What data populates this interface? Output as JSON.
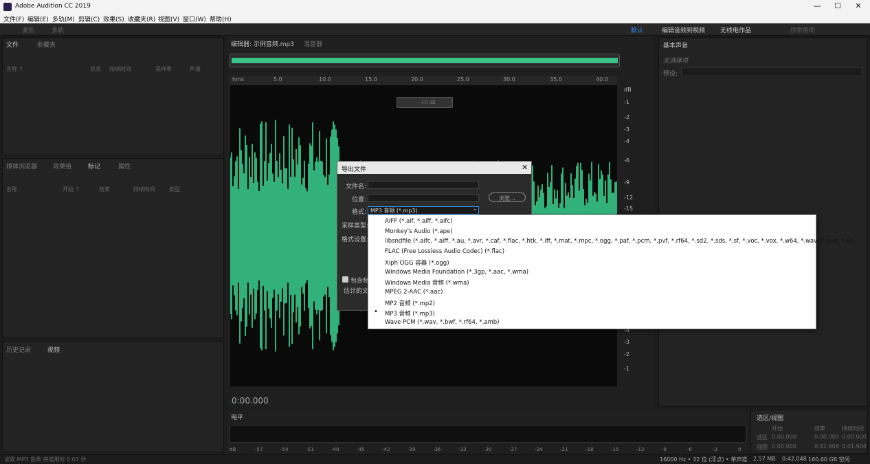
{
  "window": {
    "title": "Adobe Audition CC 2019",
    "min": "—",
    "max": "☐",
    "close": "✕"
  },
  "menu": [
    "文件(F)",
    "编辑(E)",
    "多轨(M)",
    "剪辑(C)",
    "效果(S)",
    "收藏夹(R)",
    "视图(V)",
    "窗口(W)",
    "帮助(H)"
  ],
  "toolbar": {
    "waveform": "波形",
    "multitrack": "多轨",
    "workspace_default": "默认",
    "workspace_2": "编辑音频到视频",
    "workspace_3": "无线电作品",
    "search": "搜索帮助"
  },
  "files_panel": {
    "tab_files": "文件",
    "tab_favorites": "收藏夹",
    "headers": [
      "名称 ↑",
      "状态",
      "持续时间",
      "采样率",
      "声道"
    ]
  },
  "media_panel": {
    "tabs": [
      "媒体浏览器",
      "效果组",
      "标记",
      "属性"
    ],
    "headers": [
      "名称",
      "开始 ↑",
      "结束",
      "持续时间",
      "类型"
    ]
  },
  "history_panel": {
    "tabs": [
      "历史记录",
      "视频"
    ]
  },
  "editor": {
    "tab": "编辑器: 示例音频.mp3",
    "mixer_tab": "混音器",
    "time": "0:00.000",
    "ruler": [
      "hms",
      "5.0",
      "10.0",
      "15.0",
      "20.0",
      "25.0",
      "30.0",
      "35.0",
      "40.0"
    ],
    "db_label": "dB",
    "db_top": [
      "-1",
      "-2",
      "-3",
      "-4",
      "-6",
      "-9",
      "-12",
      "-15"
    ],
    "db_bottom": [
      "-4",
      "-3",
      "-2",
      "-1"
    ],
    "hud_gain": "+0 dB"
  },
  "right_panel": {
    "tab": "基本声音",
    "subtitle": "无选择项",
    "preset_label": "预设:"
  },
  "levels": {
    "tab": "电平",
    "scale": [
      "dB",
      "-57",
      "-54",
      "-51",
      "-48",
      "-45",
      "-42",
      "-39",
      "-36",
      "-33",
      "-30",
      "-27",
      "-24",
      "-21",
      "-18",
      "-15",
      "-12",
      "-9",
      "-6",
      "-3",
      "0"
    ]
  },
  "selection": {
    "tab": "选区/视图",
    "headers": [
      "开始",
      "结束",
      "持续时间"
    ],
    "rows": [
      {
        "label": "选区",
        "start": "0:00.000",
        "end": "0:00.000",
        "dur": "0:00.000"
      },
      {
        "label": "视图",
        "start": "0:00.000",
        "end": "0:41.908",
        "dur": "0:41.908"
      }
    ]
  },
  "status": {
    "left": "读取 MP3 音频 完成用时 0.03 秒",
    "rate": "16000 Hz • 32 位 (浮点) • 单声道",
    "size": "2.57 MB",
    "dur": "0:42.048",
    "free": "160.60 GB 空闲"
  },
  "dialog": {
    "title": "导出文件",
    "filename_label": "文件名:",
    "location_label": "位置:",
    "format_label": "格式:",
    "format_value": "MP3 音频 (*.mp3)",
    "browse": "浏览...",
    "sample_type_label": "采样类型:",
    "format_settings_label": "格式设置:",
    "include_label": "包含标",
    "estimate_label": "估计的文"
  },
  "dropdown": {
    "options": [
      "AIFF (*.aif, *.aiff, *.aifc)",
      "Monkey's Audio (*.ape)",
      "libsndfile (*.aifc, *.aiff, *.au, *.avr, *.caf, *.flac, *.htk, *.iff, *.mat, *.mpc, *.ogg, *.paf, *.pcm, *.pvf, *.rf64, *.sd2, *.sds, *.sf, *.voc, *.vox, *.w64, *.wav, *.wve, *.xi)",
      "FLAC (Free Lossless Audio Codec) (*.flac)",
      "Xiph OGG 容器 (*.ogg)",
      "Windows Media Foundation (*.3gp, *.aac, *.wma)",
      "Windows Media 音频 (*.wma)",
      "MPEG 2-AAC (*.aac)",
      "MP2 音频 (*.mp2)",
      "MP3 音频 (*.mp3)",
      "Wave PCM (*.wav, *.bwf, *.rf64, *.amb)"
    ],
    "bullet": "•"
  },
  "colors": {
    "wave": "#3ddc97",
    "accent": "#2d8ceb"
  }
}
